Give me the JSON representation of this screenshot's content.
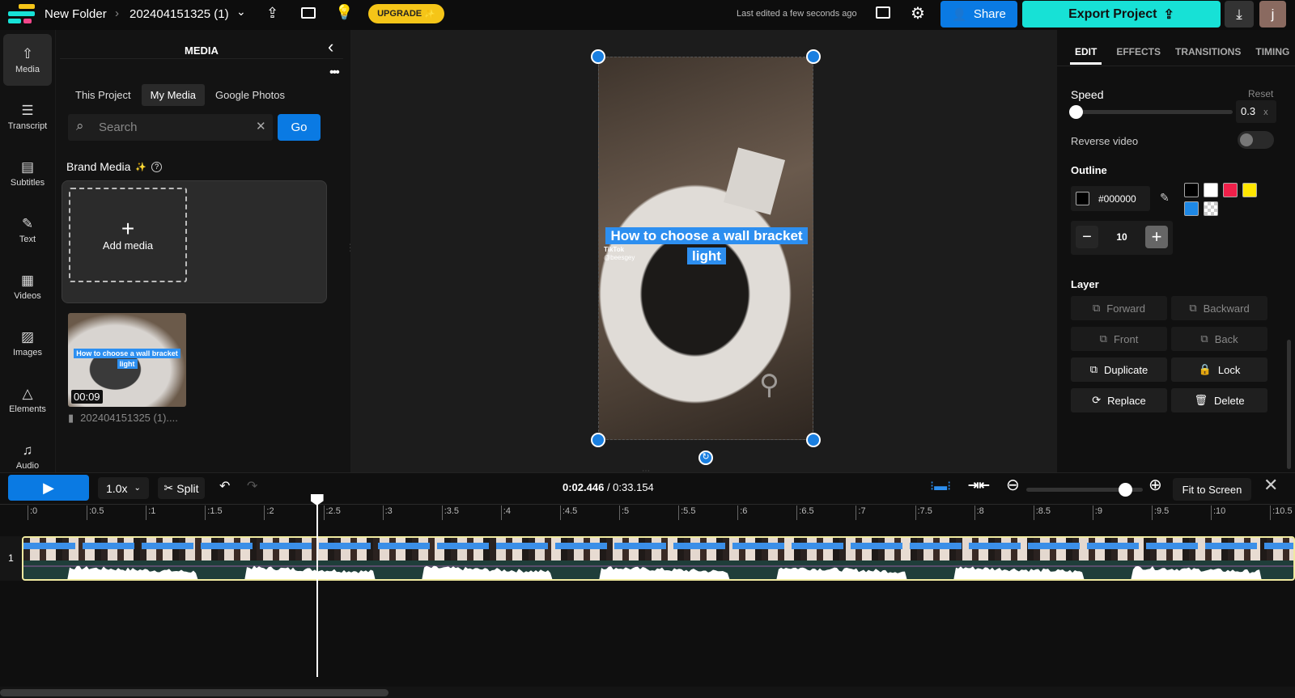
{
  "topbar": {
    "folder": "New Folder",
    "project": "202404151325 (1)",
    "upgrade": "UPGRADE",
    "last_edited": "Last edited a few seconds ago",
    "share": "Share",
    "export": "Export Project",
    "avatar": "j",
    "colors": {
      "upgrade": "#f5c518",
      "share": "#0a7ae3",
      "export": "#17e1d6",
      "avatar": "#8a6a60"
    }
  },
  "rail": [
    {
      "label": "Media",
      "icon": "upload-cloud-icon"
    },
    {
      "label": "Transcript",
      "icon": "transcript-icon"
    },
    {
      "label": "Subtitles",
      "icon": "subtitles-icon"
    },
    {
      "label": "Text",
      "icon": "text-edit-icon"
    },
    {
      "label": "Videos",
      "icon": "film-icon"
    },
    {
      "label": "Images",
      "icon": "image-icon"
    },
    {
      "label": "Elements",
      "icon": "shapes-icon"
    },
    {
      "label": "Audio",
      "icon": "music-note-icon"
    }
  ],
  "media": {
    "title": "MEDIA",
    "tabs": [
      "This Project",
      "My Media",
      "Google Photos"
    ],
    "active_tab": "My Media",
    "search_placeholder": "Search",
    "go": "Go",
    "brand_media": "Brand Media",
    "add_media": "Add media",
    "item": {
      "caption_line1": "How to choose a wall bracket",
      "caption_line2": "light",
      "duration": "00:09",
      "name": "202404151325 (1)...."
    }
  },
  "canvas": {
    "caption_line1": "How to choose a wall bracket",
    "caption_line2": "light",
    "watermark": "TikTok",
    "watermark_user": "@beesgey"
  },
  "right": {
    "tabs": [
      "EDIT",
      "EFFECTS",
      "TRANSITIONS",
      "TIMING"
    ],
    "active_tab": "EDIT",
    "speed_label": "Speed",
    "reset": "Reset",
    "speed_value": "0.3",
    "speed_unit": "x",
    "speed_fraction": 0.0,
    "reverse_label": "Reverse video",
    "reverse_on": false,
    "outline_label": "Outline",
    "outline_color": "#000000",
    "swatches": [
      "#000000",
      "#ffffff",
      "#f0204a",
      "#ffe600",
      "#1e88e5",
      "transparent"
    ],
    "outline_width": "10",
    "layer_label": "Layer",
    "layer_buttons": [
      {
        "label": "Forward",
        "enabled": false
      },
      {
        "label": "Backward",
        "enabled": false
      },
      {
        "label": "Front",
        "enabled": false
      },
      {
        "label": "Back",
        "enabled": false
      },
      {
        "label": "Duplicate",
        "enabled": true
      },
      {
        "label": "Lock",
        "enabled": true
      },
      {
        "label": "Replace",
        "enabled": true
      },
      {
        "label": "Delete",
        "enabled": true
      }
    ]
  },
  "timeline": {
    "speed": "1.0x",
    "split": "Split",
    "current": "0:02.446",
    "total": "0:33.154",
    "fit": "Fit to Screen",
    "zoom_level": 0.85,
    "ticks": [
      ":0",
      ":0.5",
      ":1",
      ":1.5",
      ":2",
      ":2.5",
      ":3",
      ":3.5",
      ":4",
      ":4.5",
      ":5",
      ":5.5",
      ":6",
      ":6.5",
      ":7",
      ":7.5",
      ":8",
      ":8.5",
      ":9",
      ":9.5",
      ":10",
      ":10.5"
    ],
    "track_number": "1",
    "playhead_seconds": 2.446
  }
}
